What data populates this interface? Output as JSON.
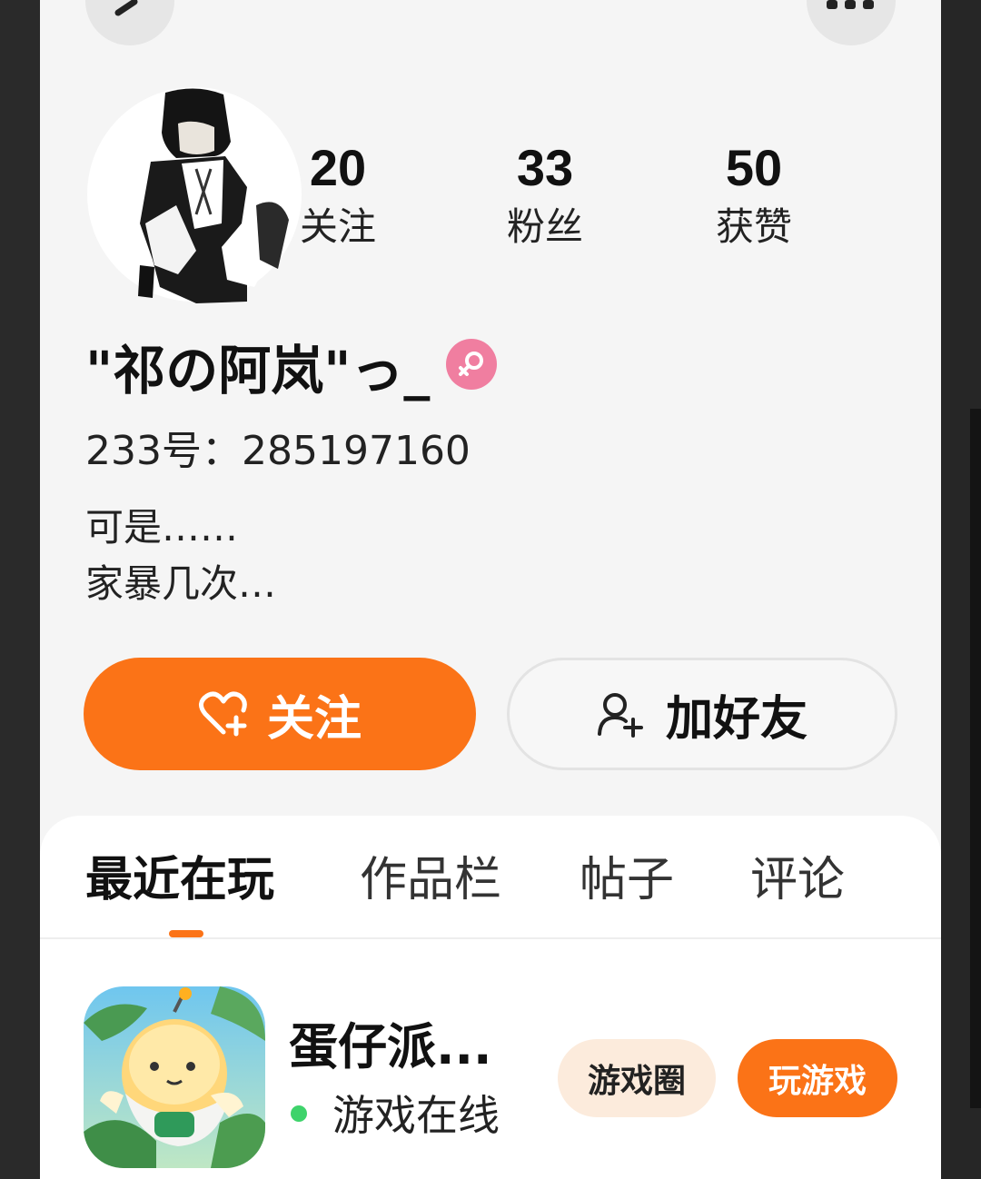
{
  "stats": [
    {
      "count": "20",
      "label": "关注"
    },
    {
      "count": "33",
      "label": "粉丝"
    },
    {
      "count": "50",
      "label": "获赞"
    }
  ],
  "profile": {
    "username": "\"祁の阿岚\"っ_",
    "uid": "233号：285197160",
    "bio_line1": "可是……",
    "bio_line2": "家暴几次…"
  },
  "actions": {
    "follow_label": "关注",
    "add_friend_label": "加好友"
  },
  "tabs": [
    {
      "label": "最近在玩",
      "active": true
    },
    {
      "label": "作品栏",
      "active": false
    },
    {
      "label": "帖子",
      "active": false
    },
    {
      "label": "评论",
      "active": false
    }
  ],
  "game": {
    "name": "蛋仔派...",
    "status": "游戏在线",
    "circle_label": "游戏圈",
    "play_label": "玩游戏"
  },
  "colors": {
    "accent": "#fb7317",
    "gender_badge": "#f07ea0",
    "online": "#3ed36b"
  }
}
